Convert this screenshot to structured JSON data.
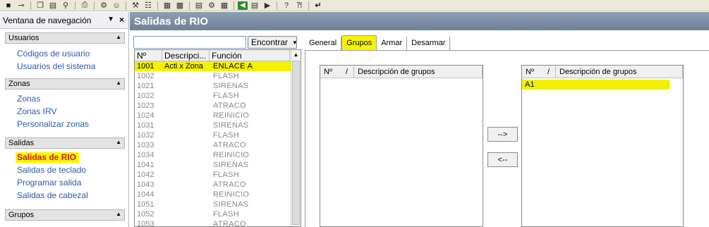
{
  "toolbar": {
    "icons": [
      "save-icon",
      "attach-icon",
      "copy-icon",
      "paste-icon",
      "search-icon",
      "print-icon",
      "tools-icon",
      "user-icon",
      "config-icon",
      "network-icon",
      "report-icon",
      "monitor-icon",
      "back-icon",
      "document-icon",
      "forward-icon",
      "help-icon",
      "context-help-icon",
      "exit-icon"
    ]
  },
  "nav": {
    "title": "Ventana de navegación",
    "groups": [
      {
        "label": "Usuarios",
        "items": [
          "Códigos de usuario",
          "Usuarios del sistema"
        ]
      },
      {
        "label": "Zonas",
        "items": [
          "Zonas",
          "Zonas IRV",
          "Personalizar zonas"
        ]
      },
      {
        "label": "Salidas",
        "items": [
          "Salidas de RIO",
          "Salidas de teclado",
          "Programar salida",
          "Salidas de cabezal"
        ]
      },
      {
        "label": "Grupos",
        "items": []
      }
    ]
  },
  "main": {
    "title": "Salidas de RIO"
  },
  "search": {
    "value": "",
    "button": "Encontrar"
  },
  "grid": {
    "headers": [
      "Nº",
      "Descripci...",
      "Función"
    ],
    "rows": [
      {
        "no": "1001",
        "desc": "Acti x Zona",
        "func": "ENLACE A"
      },
      {
        "no": "1002",
        "desc": "",
        "func": "FLASH"
      },
      {
        "no": "1021",
        "desc": "",
        "func": "SIRENAS"
      },
      {
        "no": "1022",
        "desc": "",
        "func": "FLASH"
      },
      {
        "no": "1023",
        "desc": "",
        "func": "ATRACO"
      },
      {
        "no": "1024",
        "desc": "",
        "func": "REINICIO"
      },
      {
        "no": "1031",
        "desc": "",
        "func": "SIRENAS"
      },
      {
        "no": "1032",
        "desc": "",
        "func": "FLASH"
      },
      {
        "no": "1033",
        "desc": "",
        "func": "ATRACO"
      },
      {
        "no": "1034",
        "desc": "",
        "func": "REINICIO"
      },
      {
        "no": "1041",
        "desc": "",
        "func": "SIRENAS"
      },
      {
        "no": "1042",
        "desc": "",
        "func": "FLASH"
      },
      {
        "no": "1043",
        "desc": "",
        "func": "ATRACO"
      },
      {
        "no": "1044",
        "desc": "",
        "func": "REINICIO"
      },
      {
        "no": "1051",
        "desc": "",
        "func": "SIRENAS"
      },
      {
        "no": "1052",
        "desc": "",
        "func": "FLASH"
      },
      {
        "no": "1053",
        "desc": "",
        "func": "ATRACO"
      }
    ]
  },
  "tabs": [
    "General",
    "Grupos",
    "Armar",
    "Desarmar"
  ],
  "groups_panel": {
    "left_headers": [
      "Nº",
      "Descripción de grupos"
    ],
    "right_headers": [
      "Nº",
      "Descripción de grupos"
    ],
    "assigned": [
      "A1"
    ],
    "add_button": "-->",
    "remove_button": "<--"
  },
  "colors": {
    "highlight": "#f8f500",
    "header_bar": "#7d8ea3",
    "link": "#2a5aa8",
    "active_link": "#d81818"
  }
}
